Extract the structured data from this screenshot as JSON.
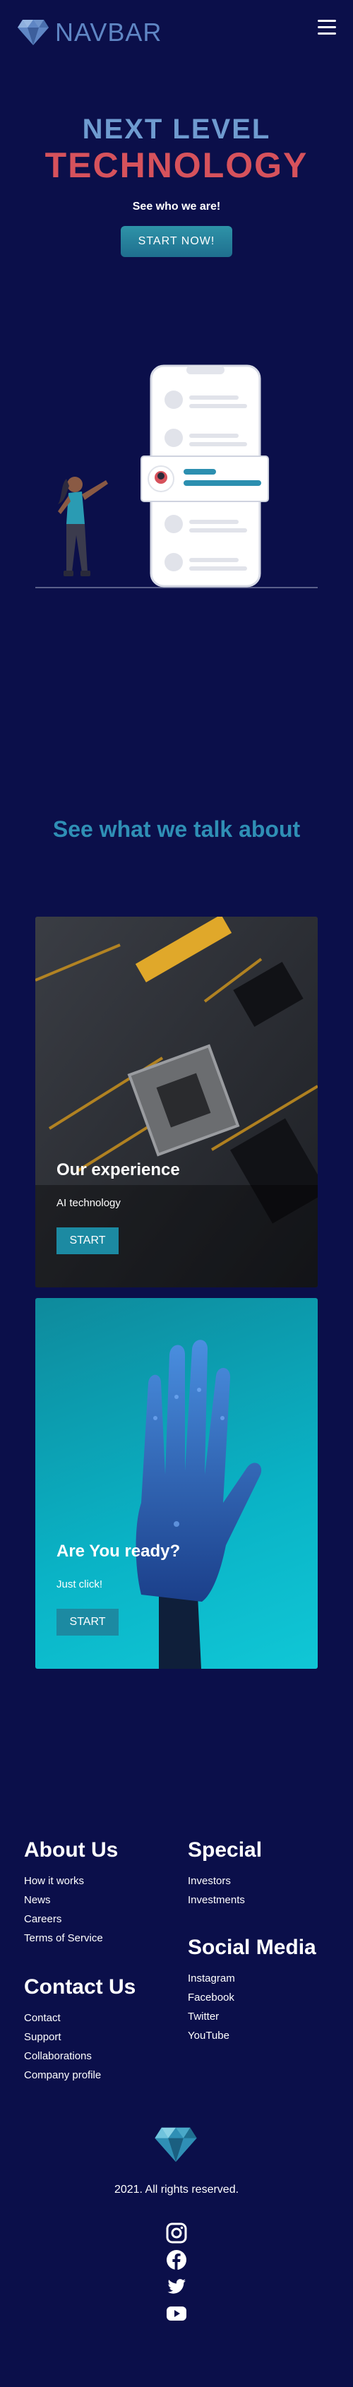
{
  "navbar": {
    "brand": "NAVBAR",
    "logo_icon": "diamond-icon",
    "menu_icon": "hamburger-menu-icon"
  },
  "hero": {
    "line1": "NEXT LEVEL",
    "line2": "TECHNOLOGY",
    "subtitle": "See who we are!",
    "button": "START NOW!"
  },
  "section_title": "See what we talk about",
  "cards": [
    {
      "title": "Our experience",
      "subtitle": "AI technology",
      "button": "START"
    },
    {
      "title": "Are You ready?",
      "subtitle": "Just click!",
      "button": "START"
    }
  ],
  "footer": {
    "about": {
      "title": "About Us",
      "links": [
        "How it works",
        "News",
        "Careers",
        "Terms of Service"
      ]
    },
    "special": {
      "title": "Special",
      "links": [
        "Investors",
        "Investments"
      ]
    },
    "contact": {
      "title": "Contact Us",
      "links": [
        "Contact",
        "Support",
        "Collaborations",
        "Company profile"
      ]
    },
    "social": {
      "title": "Social Media",
      "links": [
        "Instagram",
        "Facebook",
        "Twitter",
        "YouTube"
      ]
    },
    "copyright": "2021. All rights reserved.",
    "icons": [
      "instagram-icon",
      "facebook-icon",
      "twitter-icon",
      "youtube-icon"
    ]
  },
  "colors": {
    "background": "#0b0f4a",
    "accent": "#2f8fb5",
    "highlight": "#d6525c"
  }
}
